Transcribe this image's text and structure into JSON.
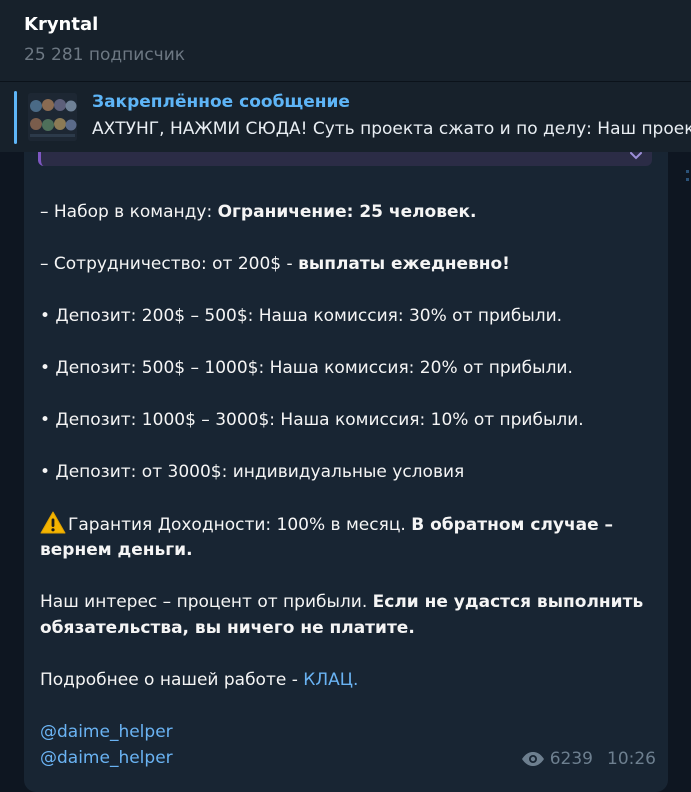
{
  "channel": {
    "name": "Kryntal",
    "subscribers": "25 281 подписчик"
  },
  "pinned": {
    "title": "Закреплённое сообщение",
    "text": "АХТУНГ, НАЖМИ СЮДА!  Суть проекта сжато и по делу: Наш проект"
  },
  "message": {
    "team_prefix": "– Набор в команду: ",
    "team_bold": "Ограничение: 25 человек.",
    "coop_prefix": "– Сотрудничество: от 200$ - ",
    "coop_bold": "выплаты ежедневно!",
    "deposit_1": "• Депозит: 200$ – 500$: Наша комиссия: 30% от прибыли.",
    "deposit_2": "• Депозит: 500$ – 1000$: Наша комиссия: 20% от прибыли.",
    "deposit_3": "• Депозит: 1000$ – 3000$: Наша комиссия: 10% от прибыли.",
    "deposit_4": "• Депозит: от 3000$: индивидуальные условия",
    "guarantee_prefix": "Гарантия Доходности: 100% в месяц. ",
    "guarantee_bold_1": "В обратном случае –",
    "guarantee_bold_2": "вернем деньги.",
    "interest_prefix": "Наш интерес – процент от прибыли. ",
    "interest_bold_1": "Если не удастся выполнить",
    "interest_bold_2": "обязательства, вы ничего не платите.",
    "more_prefix": "Подробнее о нашей работе - ",
    "more_link": "КЛАЦ.",
    "helper_1": "@daime_helper",
    "helper_2": "@daime_helper",
    "views": "6239",
    "time": "10:26"
  },
  "icons": {
    "warning": "warning-icon",
    "views": "eye-icon",
    "expand": "chevron-down-icon"
  },
  "colors": {
    "background": "#0e1621",
    "header": "#17212b",
    "bubble": "#182533",
    "accent": "#5eb5f7",
    "link": "#6ab3f3",
    "muted": "#6d7f8f"
  }
}
